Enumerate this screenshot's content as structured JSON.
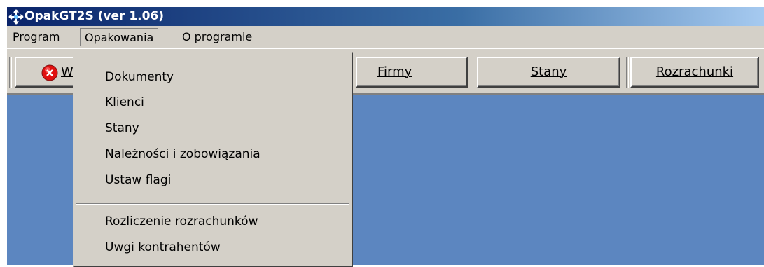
{
  "window": {
    "title": "OpakGT2S (ver 1.06)"
  },
  "menubar": {
    "items": [
      {
        "label": "Program"
      },
      {
        "label": "Opakowania"
      },
      {
        "label": "O programie"
      }
    ]
  },
  "toolbar": {
    "buttons": [
      {
        "label": "W",
        "icon": "exit-icon"
      },
      {
        "label": "Firmy"
      },
      {
        "label": "Stany"
      },
      {
        "label": "Rozrachunki"
      }
    ]
  },
  "dropdown": {
    "items": [
      {
        "label": "Dokumenty"
      },
      {
        "label": "Klienci"
      },
      {
        "label": "Stany"
      },
      {
        "label": "Należności i zobowiązania"
      },
      {
        "label": "Ustaw flagi"
      },
      {
        "label": "Rozliczenie rozrachunków"
      },
      {
        "label": "Uwgi kontrahentów"
      }
    ]
  },
  "colors": {
    "titlebar": "#0a246a",
    "client_area": "#5c86c0",
    "face": "#d4d0c8"
  }
}
